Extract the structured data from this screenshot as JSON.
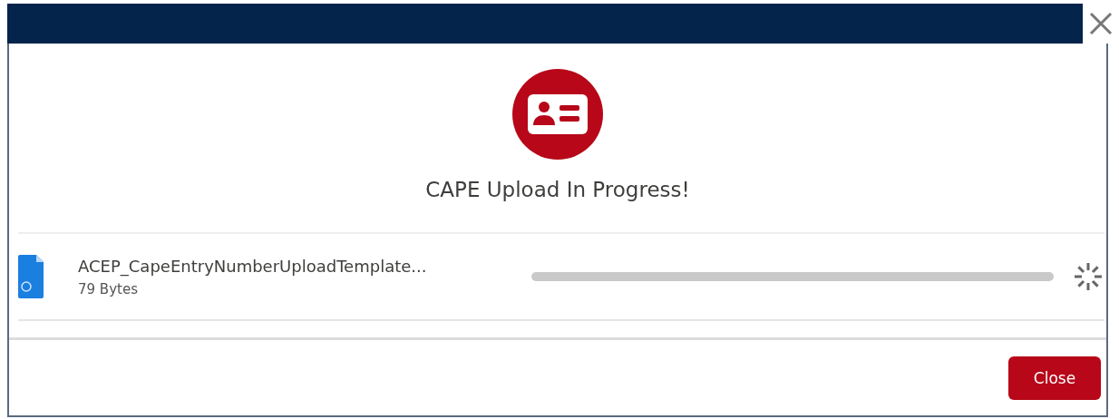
{
  "dialog": {
    "title": "CAPE Upload In Progress!"
  },
  "files": [
    {
      "name": "ACEP_CapeEntryNumberUploadTemplate...",
      "size": "79 Bytes"
    }
  ],
  "buttons": [
    "Close"
  ]
}
